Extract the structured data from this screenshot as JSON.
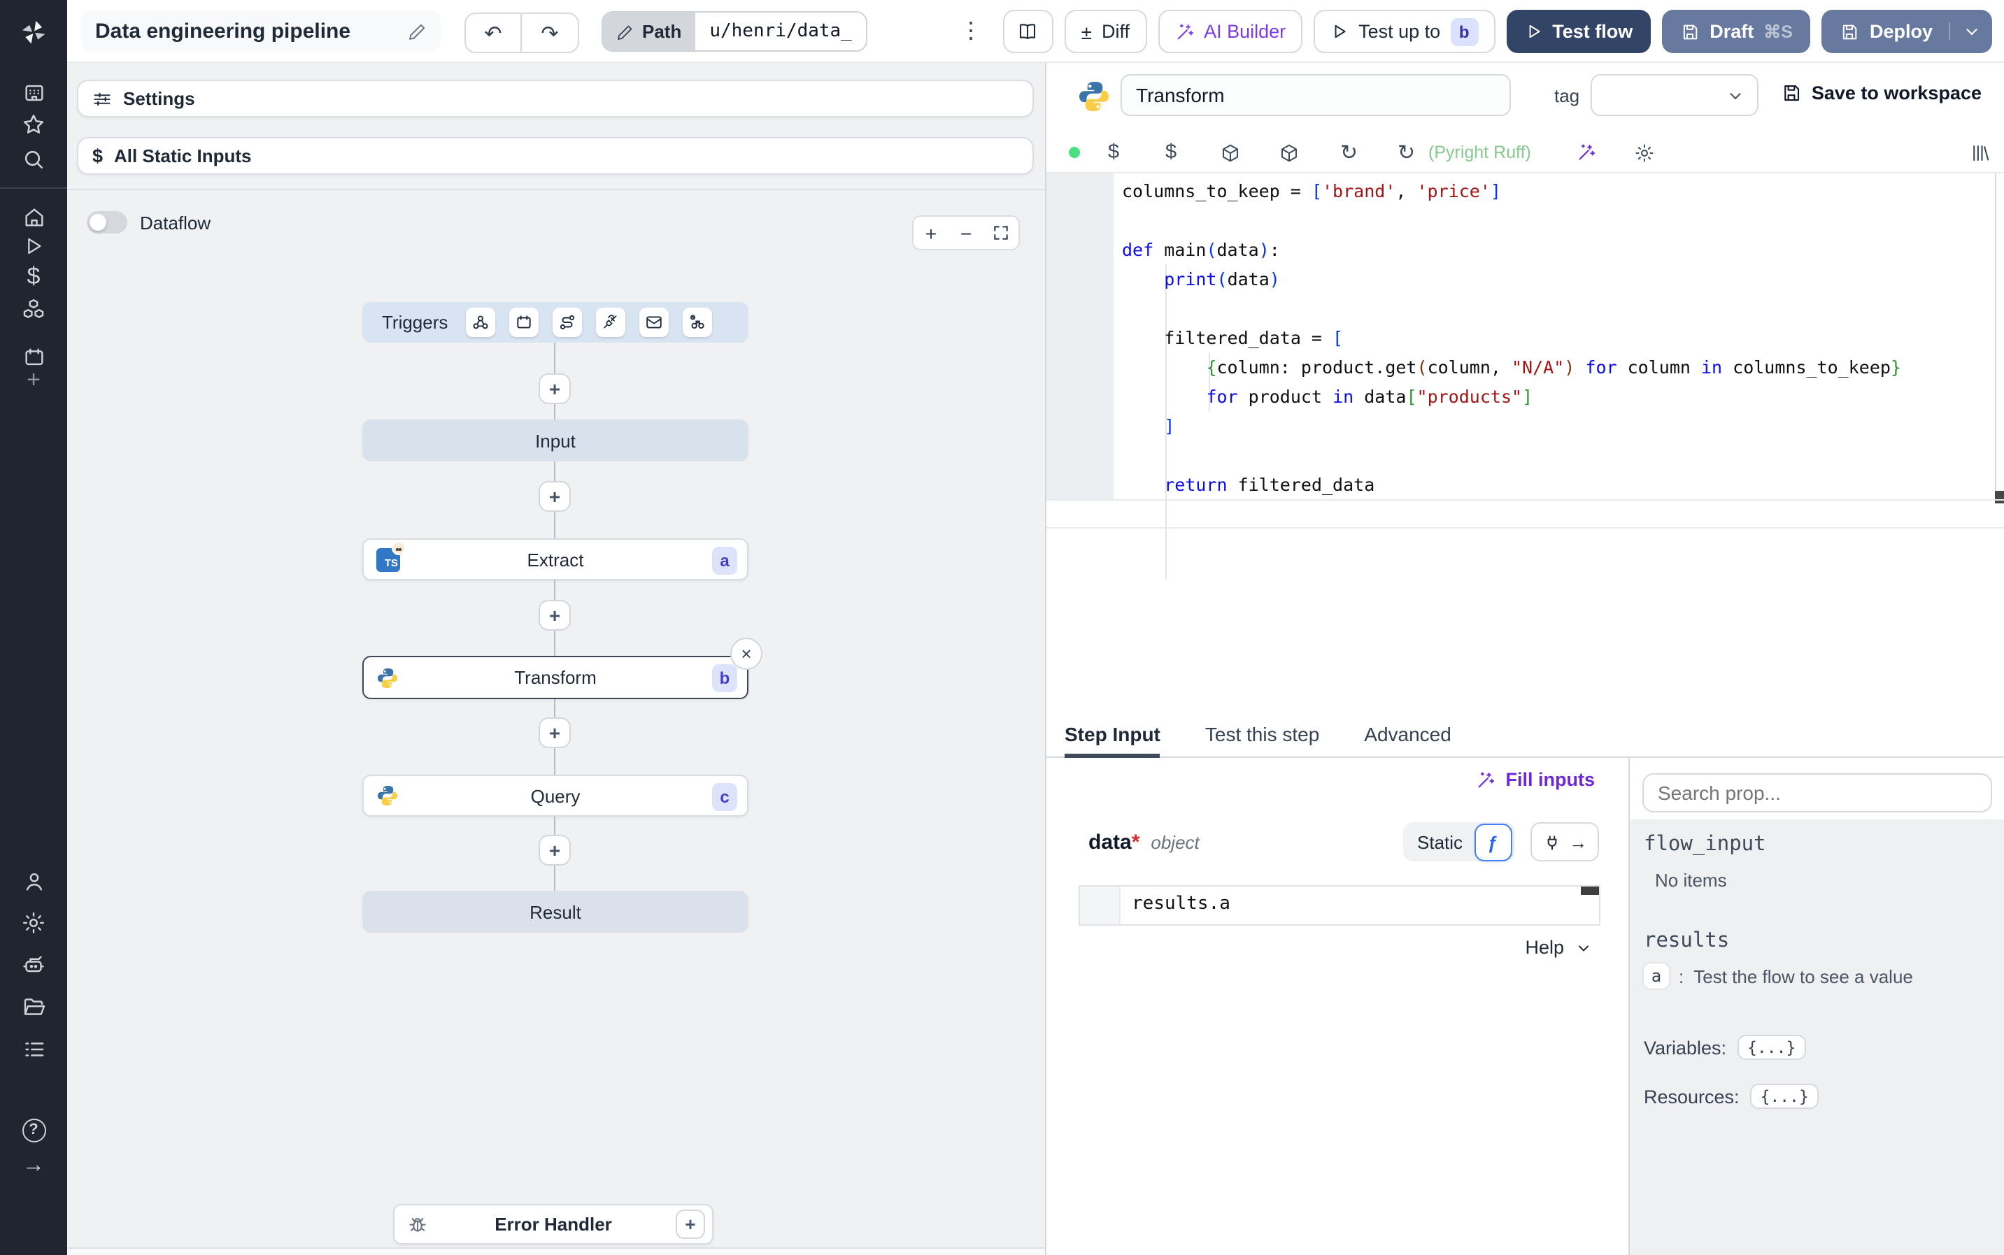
{
  "topbar": {
    "title": "Data engineering pipeline",
    "path_label": "Path",
    "path_value": "u/henri/data_",
    "diff_sign": "±",
    "diff_label": "Diff",
    "ai_builder_label": "AI Builder",
    "test_up_to_label": "Test up to",
    "test_up_to_badge": "b",
    "test_flow_label": "Test flow",
    "draft_label": "Draft",
    "draft_shortcut": "⌘S",
    "deploy_label": "Deploy"
  },
  "flow": {
    "settings_label": "Settings",
    "all_static_inputs_label": "All Static Inputs",
    "dataflow_label": "Dataflow",
    "triggers_label": "Triggers",
    "input_label": "Input",
    "extract": {
      "label": "Extract",
      "badge": "a",
      "lang": "TS"
    },
    "transform": {
      "label": "Transform",
      "badge": "b"
    },
    "query": {
      "label": "Query",
      "badge": "c"
    },
    "result_label": "Result",
    "error_handler_label": "Error Handler"
  },
  "step": {
    "name": "Transform",
    "tag_label": "tag",
    "save_label": "Save to workspace",
    "lint_status": "(Pyright Ruff)"
  },
  "code": {
    "language": "python",
    "lines": [
      [
        [
          "d",
          "columns_to_keep = "
        ],
        [
          "b1",
          "["
        ],
        [
          "s",
          "'brand'"
        ],
        [
          "d",
          ", "
        ],
        [
          "s",
          "'price'"
        ],
        [
          "b1",
          "]"
        ]
      ],
      [],
      [
        [
          "k",
          "def "
        ],
        [
          "d",
          "main"
        ],
        [
          "b1",
          "("
        ],
        [
          "d",
          "data"
        ],
        [
          "b1",
          ")"
        ],
        [
          "d",
          ":"
        ]
      ],
      [
        [
          "d",
          "    "
        ],
        [
          "k",
          "print"
        ],
        [
          "b1",
          "("
        ],
        [
          "d",
          "data"
        ],
        [
          "b1",
          ")"
        ]
      ],
      [],
      [
        [
          "d",
          "    filtered_data = "
        ],
        [
          "b1",
          "["
        ]
      ],
      [
        [
          "d",
          "        "
        ],
        [
          "b2",
          "{"
        ],
        [
          "d",
          "column: product.get"
        ],
        [
          "b3",
          "("
        ],
        [
          "d",
          "column, "
        ],
        [
          "s",
          "\"N/A\""
        ],
        [
          "b3",
          ")"
        ],
        [
          "k",
          " for "
        ],
        [
          "d",
          "column "
        ],
        [
          "k",
          "in "
        ],
        [
          "d",
          "columns_to_keep"
        ],
        [
          "b2",
          "}"
        ]
      ],
      [
        [
          "d",
          "        "
        ],
        [
          "k",
          "for "
        ],
        [
          "d",
          "product "
        ],
        [
          "k",
          "in "
        ],
        [
          "d",
          "data"
        ],
        [
          "b2",
          "["
        ],
        [
          "s",
          "\"products\""
        ],
        [
          "b2",
          "]"
        ]
      ],
      [
        [
          "d",
          "    "
        ],
        [
          "b1",
          "]"
        ]
      ],
      [],
      [
        [
          "d",
          "    "
        ],
        [
          "k",
          "return "
        ],
        [
          "d",
          "filtered_data"
        ]
      ]
    ]
  },
  "tabs": {
    "step_input": "Step Input",
    "test_this_step": "Test this step",
    "advanced": "Advanced"
  },
  "step_input": {
    "fill_inputs_label": "Fill inputs",
    "arg_name": "data",
    "required_mark": "*",
    "arg_type": "object",
    "static_label": "Static",
    "value": "results.a",
    "help_label": "Help"
  },
  "props": {
    "search_placeholder": "Search prop...",
    "flow_input_label": "flow_input",
    "no_items_label": "No items",
    "results_label": "results",
    "result_key": "a",
    "result_separator": ":",
    "result_hint": "Test the flow to see a value",
    "variables_label": "Variables:",
    "resources_label": "Resources:",
    "object_preview": "{...}"
  },
  "icons": {
    "kebab": "⋮",
    "undo": "↶",
    "redo": "↷",
    "refresh": "↻",
    "plus": "+",
    "minus": "−",
    "close": "×",
    "arrow_right": "→",
    "fx": "ƒ",
    "help": "?",
    "dollar": "$"
  },
  "colors": {
    "test_flow_bg": "#334566",
    "deploy_bg": "#67799e",
    "accent_purple": "#6d28d9",
    "lint_green": "#86ca8f",
    "badge_indigo_bg": "#dee3fc",
    "badge_indigo_text": "#4340c8",
    "status_green": "#4ade80",
    "sidebar_bg": "#20252f"
  }
}
